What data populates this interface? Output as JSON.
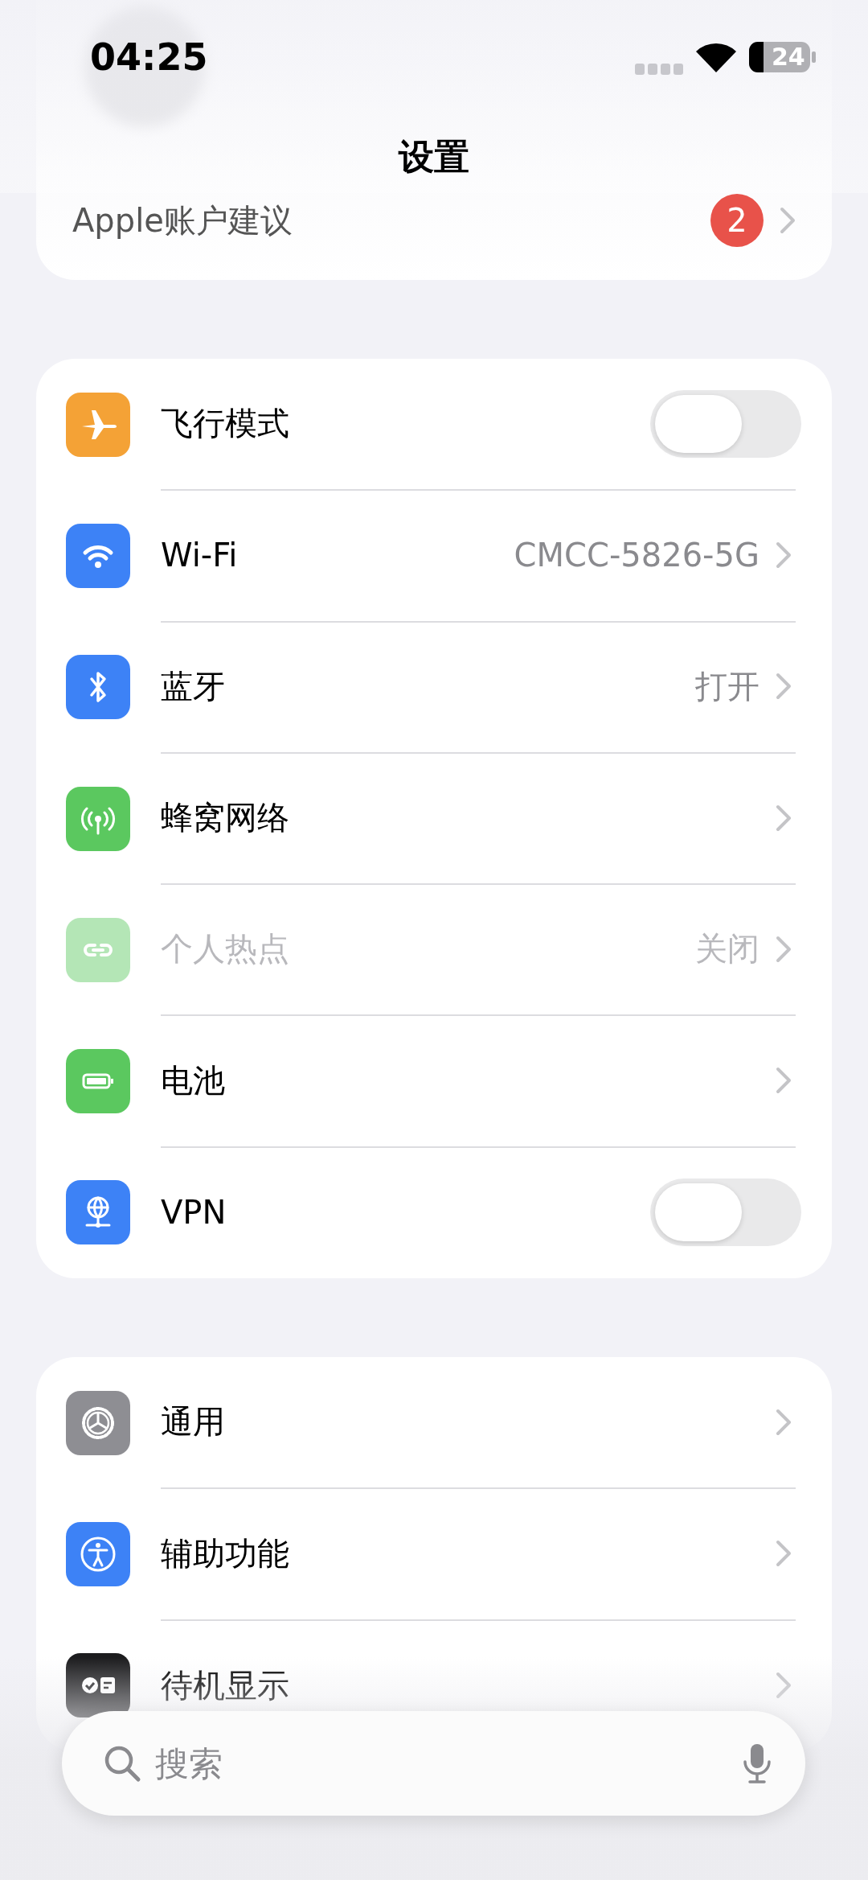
{
  "status_bar": {
    "time": "04:25",
    "battery": "24"
  },
  "title": "设置",
  "account": {
    "label": "Apple账户建议",
    "badge": "2"
  },
  "sections": [
    {
      "rows": [
        {
          "kind": "toggle",
          "label": "飞行模式",
          "on": false,
          "disabled": false
        },
        {
          "kind": "link",
          "label": "Wi-Fi",
          "value": "CMCC-5826-5G",
          "disabled": false
        },
        {
          "kind": "link",
          "label": "蓝牙",
          "value": "打开",
          "disabled": false
        },
        {
          "kind": "link",
          "label": "蜂窝网络",
          "disabled": false
        },
        {
          "kind": "link",
          "label": "个人热点",
          "value": "关闭",
          "disabled": true
        },
        {
          "kind": "link",
          "label": "电池",
          "disabled": false
        },
        {
          "kind": "toggle",
          "label": "VPN",
          "on": false,
          "disabled": false
        }
      ]
    },
    {
      "rows": [
        {
          "kind": "link",
          "label": "通用",
          "disabled": false
        },
        {
          "kind": "link",
          "label": "辅助功能",
          "disabled": false
        },
        {
          "kind": "link",
          "label": "待机显示",
          "disabled": false
        }
      ]
    }
  ],
  "search": {
    "placeholder": "搜索"
  }
}
